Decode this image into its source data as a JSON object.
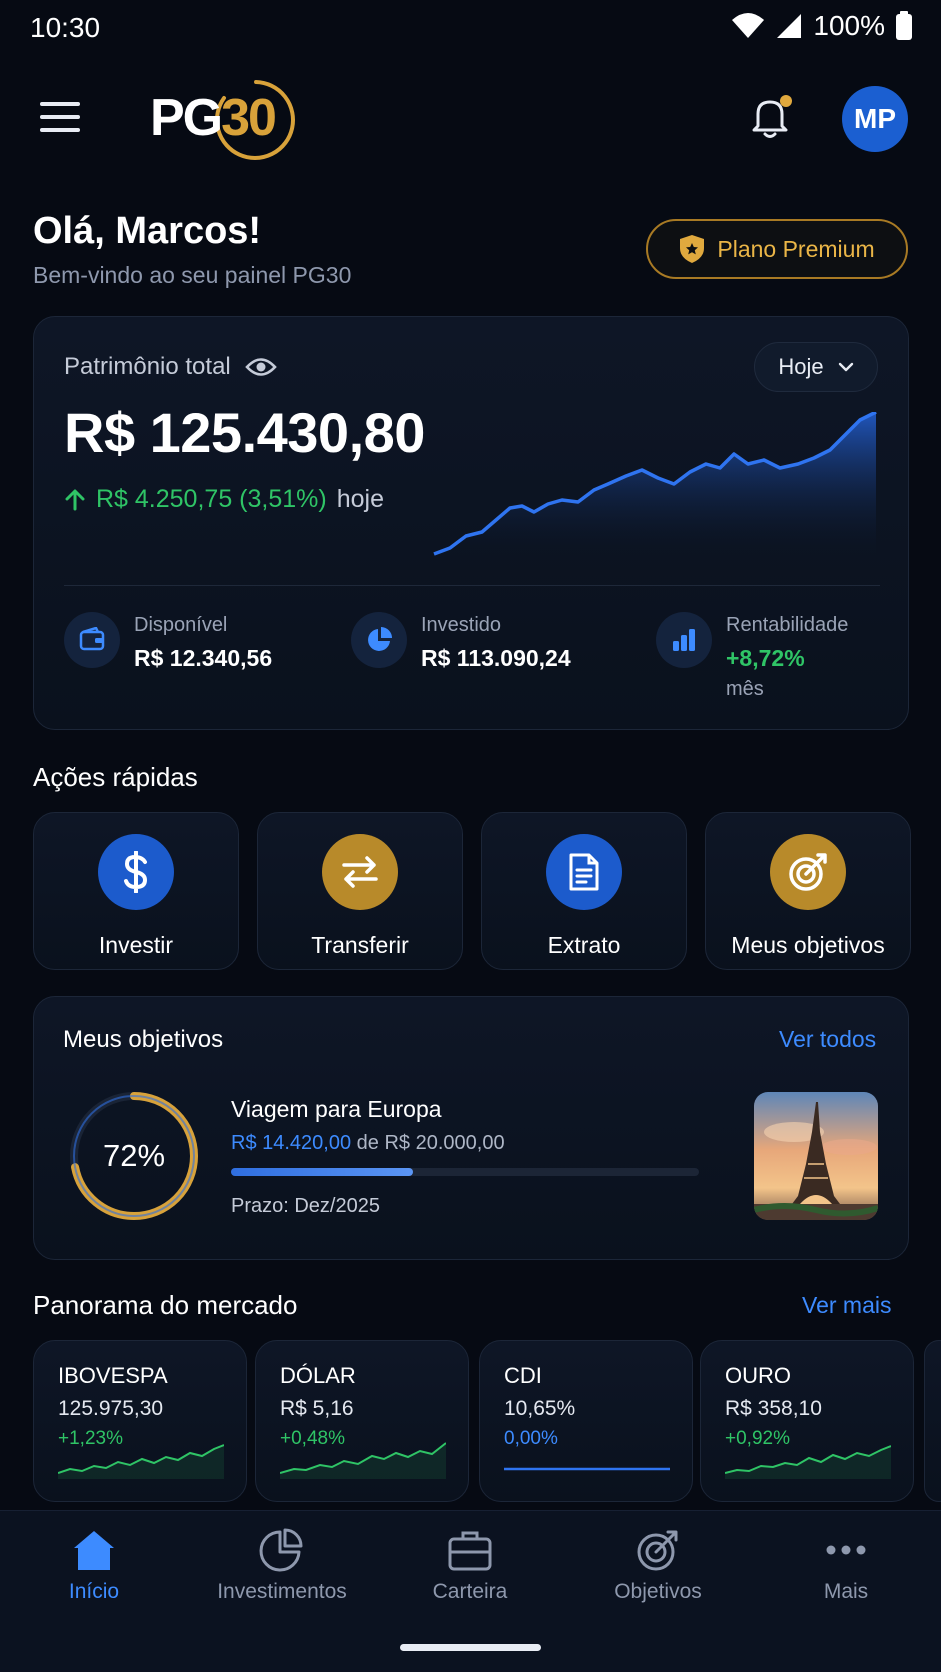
{
  "status_bar": {
    "time": "10:30",
    "battery": "100%"
  },
  "header": {
    "logo_pg": "PG",
    "logo_num": "30",
    "avatar_initials": "MP"
  },
  "greeting": {
    "title": "Olá, Marcos!",
    "subtitle": "Bem-vindo ao seu painel PG30",
    "premium_label": "Plano Premium"
  },
  "summary": {
    "label": "Patrimônio total",
    "period": "Hoje",
    "balance": "R$ 125.430,80",
    "change": "R$ 4.250,75 (3,51%)",
    "change_period": "hoje",
    "stats": [
      {
        "label": "Disponível",
        "value": "R$ 12.340,56",
        "icon": "wallet-icon"
      },
      {
        "label": "Investido",
        "value": "R$ 113.090,24",
        "icon": "pie-chart-icon"
      },
      {
        "label": "Rentabilidade",
        "value": "+8,72%",
        "sub": "mês",
        "icon": "bar-chart-icon"
      }
    ]
  },
  "quick_actions": {
    "title": "Ações rápidas",
    "items": [
      {
        "label": "Investir",
        "icon": "dollar-icon",
        "color": "#1c5bcc"
      },
      {
        "label": "Transferir",
        "icon": "transfer-arrows-icon",
        "color": "#b88a2a"
      },
      {
        "label": "Extrato",
        "icon": "document-icon",
        "color": "#1c5bcc"
      },
      {
        "label": "Meus objetivos",
        "icon": "target-icon",
        "color": "#b88a2a"
      }
    ]
  },
  "objectives": {
    "title": "Meus objetivos",
    "link": "Ver todos",
    "goal": {
      "progress_label": "72%",
      "progress": 0.72,
      "name": "Viagem para Europa",
      "current": "R$ 14.420,00",
      "of_text": "de R$ 20.000,00",
      "deadline": "Prazo: Dez/2025",
      "image": "eiffel-tower-photo"
    }
  },
  "market": {
    "title": "Panorama do mercado",
    "link": "Ver mais",
    "items": [
      {
        "name": "IBOVESPA",
        "value": "125.975,30",
        "change": "+1,23%",
        "trend": "up"
      },
      {
        "name": "DÓLAR",
        "value": "R$ 5,16",
        "change": "+0,48%",
        "trend": "up"
      },
      {
        "name": "CDI",
        "value": "10,65%",
        "change": "0,00%",
        "trend": "flat"
      },
      {
        "name": "OURO",
        "value": "R$ 358,10",
        "change": "+0,92%",
        "trend": "up"
      }
    ]
  },
  "nav": {
    "items": [
      {
        "label": "Início",
        "icon": "home-icon",
        "active": true
      },
      {
        "label": "Investimentos",
        "icon": "pie-chart-icon",
        "active": false
      },
      {
        "label": "Carteira",
        "icon": "briefcase-icon",
        "active": false
      },
      {
        "label": "Objetivos",
        "icon": "target-icon",
        "active": false
      },
      {
        "label": "Mais",
        "icon": "more-dots-icon",
        "active": false
      }
    ]
  },
  "colors": {
    "accent_blue": "#3d8bff",
    "accent_gold": "#d8a23a",
    "positive": "#2fc466",
    "background": "#060a13"
  }
}
